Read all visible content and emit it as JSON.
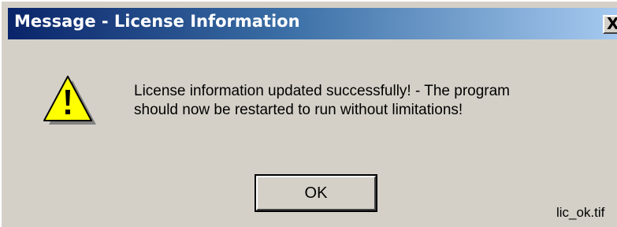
{
  "window": {
    "title": "Message - License Information",
    "close_label": "X"
  },
  "dialog": {
    "icon": "warning-icon",
    "message_line1": "License information updated successfully! - The program",
    "message_line2": "should now be restarted to run without limitations!",
    "ok_label": "OK"
  },
  "caption": "lic_ok.tif",
  "colors": {
    "titlebar_start": "#0a246a",
    "titlebar_end": "#a6caf0",
    "dialog_bg": "#d4d0c8",
    "warning_fill": "#ffff00"
  }
}
